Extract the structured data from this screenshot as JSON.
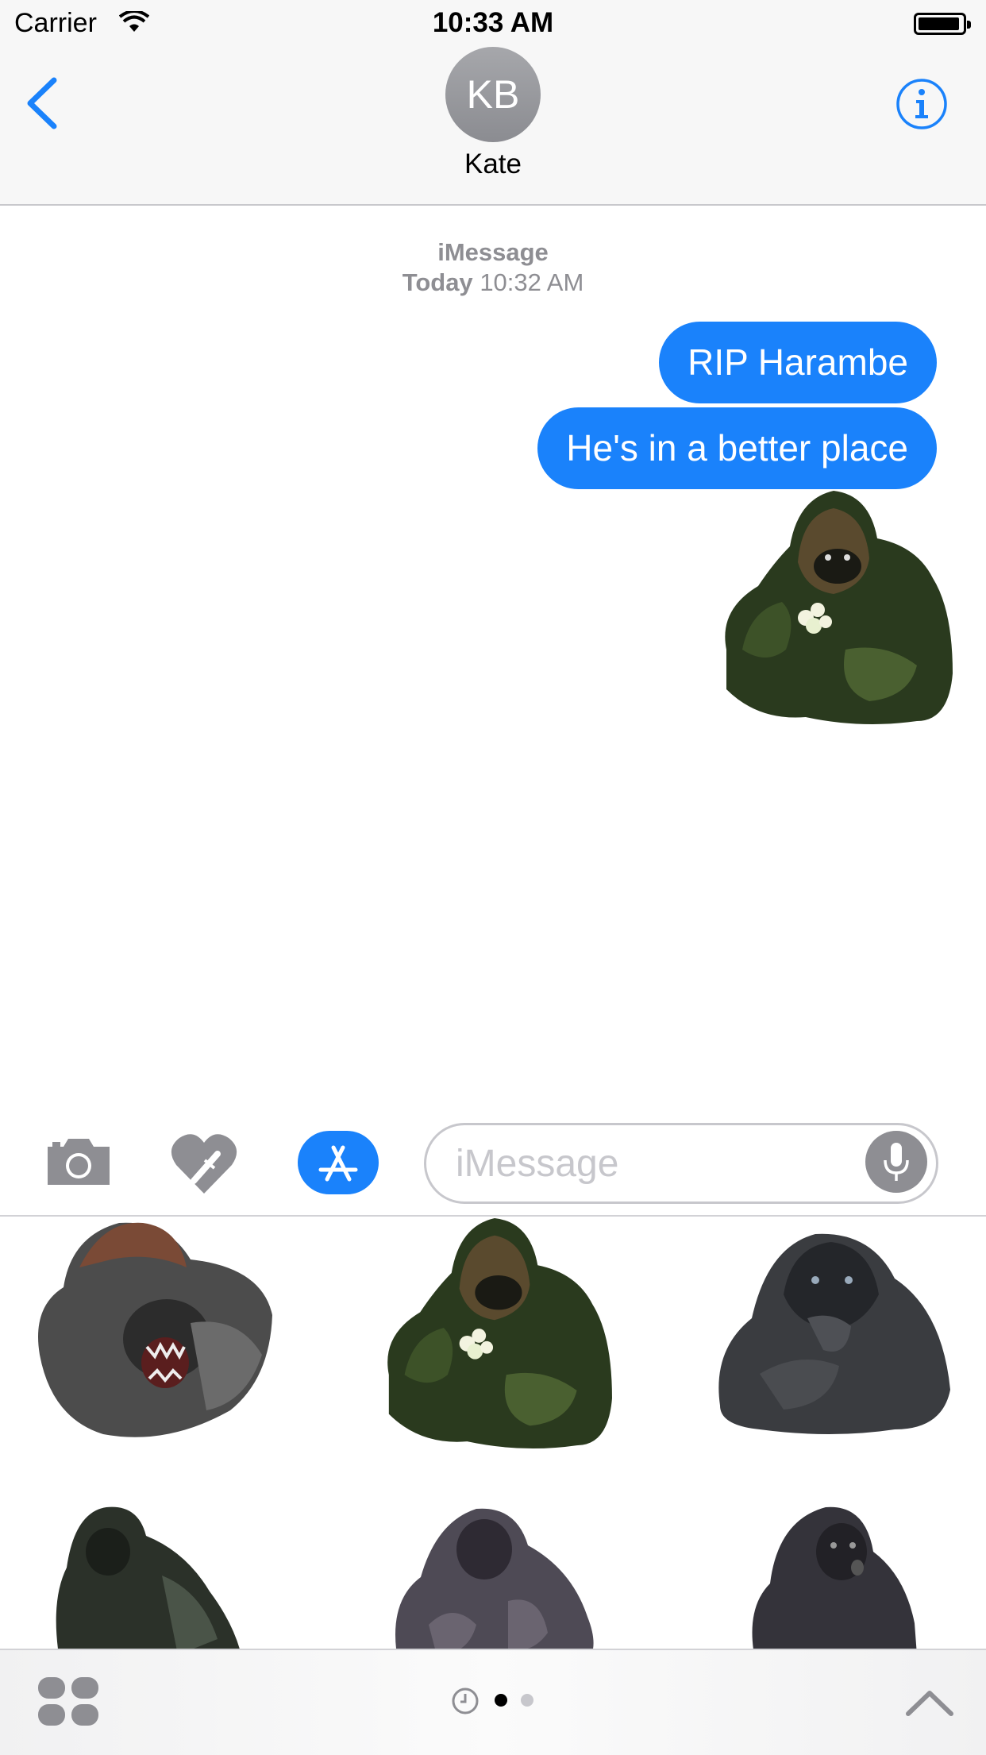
{
  "status_bar": {
    "carrier": "Carrier",
    "time": "10:33 AM"
  },
  "header": {
    "avatar_initials": "KB",
    "contact_name": "Kate"
  },
  "conversation": {
    "service": "iMessage",
    "timestamp_day": "Today",
    "timestamp_time": "10:32 AM",
    "messages": [
      {
        "text": "RIP Harambe",
        "from": "me"
      },
      {
        "text": "He's in a better place",
        "from": "me"
      }
    ],
    "sent_sticker": "gorilla-eating-flowers"
  },
  "input": {
    "placeholder": "iMessage"
  },
  "drawer": {
    "stickers": [
      "gorilla-roaring",
      "gorilla-eating-flowers",
      "gorilla-thinking",
      "gorilla-walking",
      "gorilla-standing",
      "gorilla-looking"
    ],
    "page_count": 2,
    "active_page": 1
  },
  "colors": {
    "accent": "#1a82fb",
    "bubble_text": "#ffffff",
    "secondary_text": "#8e8e93",
    "header_bg": "#f7f7f7"
  }
}
